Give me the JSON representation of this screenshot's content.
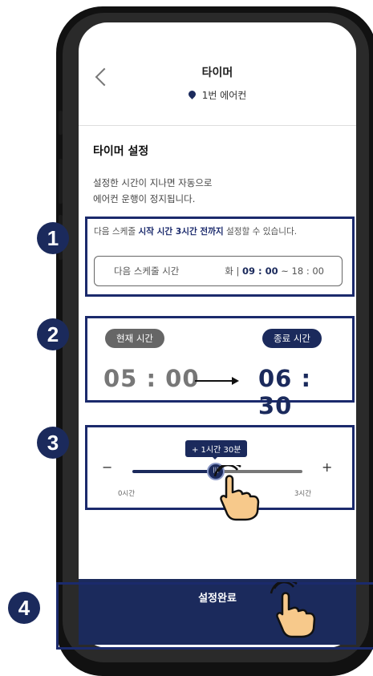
{
  "header": {
    "title": "타이머",
    "device": "1번 에어컨"
  },
  "section": {
    "title": "타이머 설정",
    "desc_line1": "설정한 시간이 지나면 자동으로",
    "desc_line2": "에어컨 운행이 정지됩니다."
  },
  "notice": {
    "prefix": "다음 스케줄 ",
    "highlight": "시작 시간 3시간 전까지",
    "suffix": " 설정할 수 있습니다."
  },
  "schedule": {
    "label": "다음 스케줄 시간",
    "day": "화  |  ",
    "start": "09 : 00",
    "end": " ~ 18 : 00"
  },
  "times": {
    "current_label": "현재 시간",
    "end_label": "종료 시간",
    "current": "05 : 00",
    "end": "06 : 30"
  },
  "slider": {
    "tooltip": "+ 1시간 30분",
    "minus": "−",
    "plus": "+",
    "min_label": "0시간",
    "max_label": "3시간",
    "value_fraction": 0.5
  },
  "confirm": {
    "label": "설정완료"
  },
  "badges": [
    "1",
    "2",
    "3",
    "4"
  ],
  "colors": {
    "accent": "#1b2a5c",
    "outline": "#1b2a6c",
    "current_pill": "#666666",
    "current_time": "#777777"
  }
}
